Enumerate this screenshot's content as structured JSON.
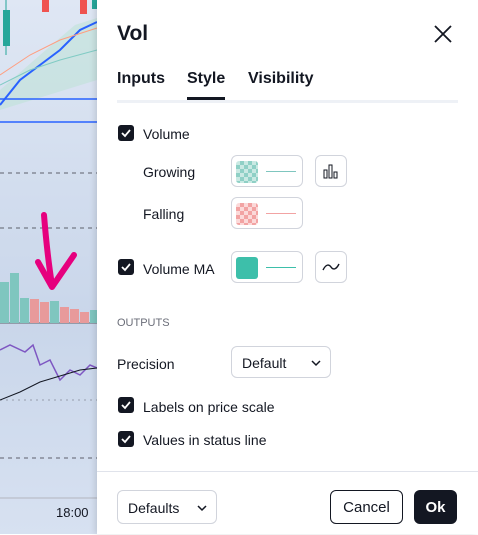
{
  "chart": {
    "time_label": "18:00",
    "colors": {
      "bg": "#d6e0f0",
      "up": "#26a69a",
      "down": "#ef5350",
      "ma_blue": "#2962ff",
      "rsi_purple": "#7e57c2",
      "annotation": "#e6007e"
    }
  },
  "dialog": {
    "title": "Vol",
    "close_icon": "close-icon",
    "tabs": [
      {
        "label": "Inputs",
        "active": false
      },
      {
        "label": "Style",
        "active": true
      },
      {
        "label": "Visibility",
        "active": false
      }
    ],
    "style": {
      "volume": {
        "label": "Volume",
        "checked": true
      },
      "growing": {
        "label": "Growing",
        "color": "#26a69a",
        "icon": "columns-icon"
      },
      "falling": {
        "label": "Falling",
        "color": "#ef5350"
      },
      "volume_ma": {
        "label": "Volume MA",
        "checked": true,
        "color": "#3dbfaa",
        "icon": "line-wave-icon"
      }
    },
    "outputs": {
      "section_label": "OUTPUTS",
      "precision_label": "Precision",
      "precision_value": "Default",
      "labels_on_price_scale": {
        "label": "Labels on price scale",
        "checked": true
      },
      "values_in_status_line": {
        "label": "Values in status line",
        "checked": true
      }
    },
    "footer": {
      "defaults": "Defaults",
      "cancel": "Cancel",
      "ok": "Ok"
    }
  }
}
